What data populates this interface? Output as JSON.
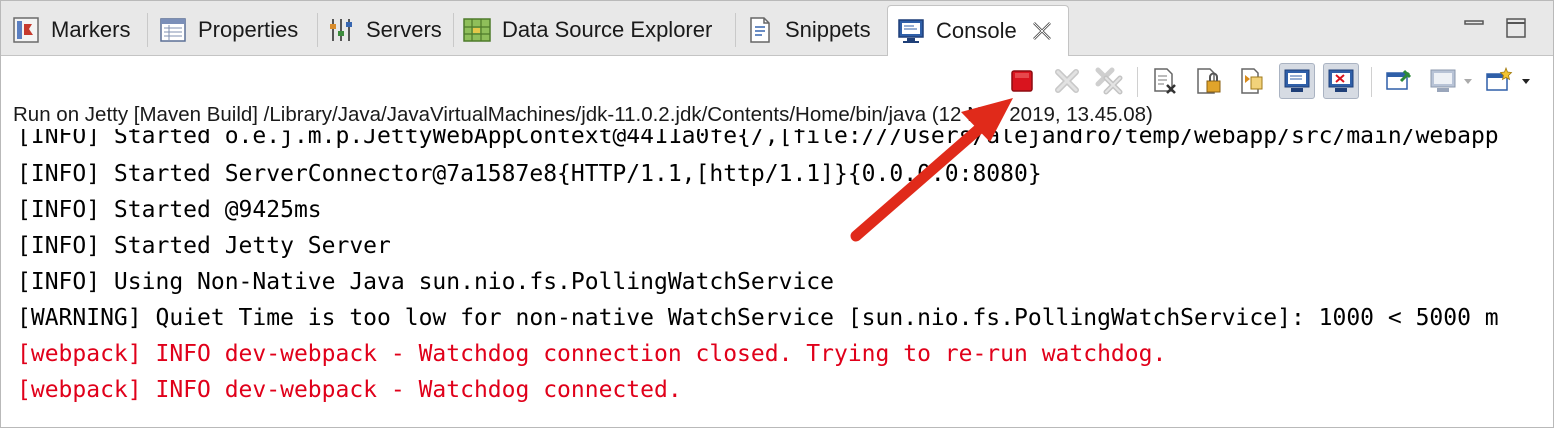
{
  "tabs": [
    {
      "label": "Markers",
      "icon": "markers-icon"
    },
    {
      "label": "Properties",
      "icon": "properties-icon"
    },
    {
      "label": "Servers",
      "icon": "servers-icon"
    },
    {
      "label": "Data Source Explorer",
      "icon": "data-source-explorer-icon"
    },
    {
      "label": "Snippets",
      "icon": "snippets-icon"
    },
    {
      "label": "Console",
      "icon": "console-icon",
      "active": true
    }
  ],
  "window_controls": [
    "minimize-icon",
    "maximize-icon"
  ],
  "toolbar": {
    "buttons": [
      "terminate-icon",
      "remove-launch-icon",
      "remove-all-terminated-icon",
      "clear-console-icon",
      "scroll-lock-icon",
      "word-wrap-icon",
      "show-console-on-stdout-icon",
      "show-console-on-stderr-icon",
      "pin-console-icon",
      "display-selected-console-icon",
      "open-console-icon"
    ]
  },
  "console": {
    "launch_title": "Run on Jetty [Maven Build] /Library/Java/JavaVirtualMachines/jdk-11.0.2.jdk/Contents/Home/bin/java (12 Nov 2019, 13.45.08)",
    "lines": [
      {
        "text": "[INFO] Started o.e.j.m.p.JettyWebAppContext@4411a0fe{/,[file:///Users/alejandro/temp/webapp/src/main/webapp",
        "error": false
      },
      {
        "text": "[INFO] Started ServerConnector@7a1587e8{HTTP/1.1,[http/1.1]}{0.0.0.0:8080}",
        "error": false
      },
      {
        "text": "[INFO] Started @9425ms",
        "error": false
      },
      {
        "text": "[INFO] Started Jetty Server",
        "error": false
      },
      {
        "text": "[INFO] Using Non-Native Java sun.nio.fs.PollingWatchService",
        "error": false
      },
      {
        "text": "[WARNING] Quiet Time is too low for non-native WatchService [sun.nio.fs.PollingWatchService]: 1000 < 5000 m",
        "error": false
      },
      {
        "text": "[webpack] INFO dev-webpack - Watchdog connection closed. Trying to re-run watchdog.",
        "error": true
      },
      {
        "text": "[webpack] INFO dev-webpack - Watchdog connected.",
        "error": true
      }
    ]
  },
  "colors": {
    "error_text": "#e0001a",
    "annotation_arrow": "#e02a1a",
    "terminate": "#d9141e"
  }
}
